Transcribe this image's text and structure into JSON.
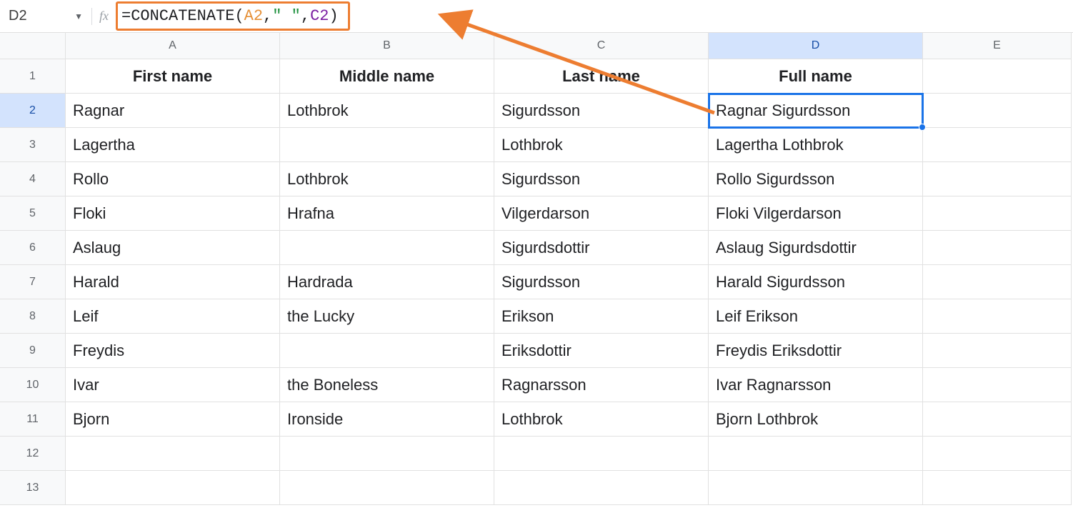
{
  "formula_bar": {
    "cell_ref": "D2",
    "formula": {
      "eq": "=",
      "fn": "CONCATENATE",
      "lp": "(",
      "refA": "A2",
      "c1": ",",
      "str": "\" \"",
      "c2": ",",
      "refC": "C2",
      "rp": ")"
    }
  },
  "columns": [
    "A",
    "B",
    "C",
    "D",
    "E"
  ],
  "active_col_idx": 3,
  "row_labels": [
    "1",
    "2",
    "3",
    "4",
    "5",
    "6",
    "7",
    "8",
    "9",
    "10",
    "11",
    "12",
    "13"
  ],
  "active_row_idx": 1,
  "headers": [
    "First name",
    "Middle name",
    "Last name",
    "Full name",
    ""
  ],
  "grid": [
    [
      "Ragnar",
      "Lothbrok",
      "Sigurdsson",
      "Ragnar Sigurdsson",
      ""
    ],
    [
      "Lagertha",
      "",
      "Lothbrok",
      "Lagertha Lothbrok",
      ""
    ],
    [
      "Rollo",
      "Lothbrok",
      "Sigurdsson",
      "Rollo Sigurdsson",
      ""
    ],
    [
      "Floki",
      "Hrafna",
      "Vilgerdarson",
      "Floki Vilgerdarson",
      ""
    ],
    [
      "Aslaug",
      "",
      "Sigurdsdottir",
      "Aslaug Sigurdsdottir",
      ""
    ],
    [
      "Harald",
      "Hardrada",
      "Sigurdsson",
      "Harald Sigurdsson",
      ""
    ],
    [
      "Leif",
      "the Lucky",
      "Erikson",
      "Leif Erikson",
      ""
    ],
    [
      "Freydis",
      "",
      "Eriksdottir",
      "Freydis Eriksdottir",
      ""
    ],
    [
      "Ivar",
      "the Boneless",
      "Ragnarsson",
      "Ivar Ragnarsson",
      ""
    ],
    [
      "Bjorn",
      "Ironside",
      "Lothbrok",
      "Bjorn Lothbrok",
      ""
    ],
    [
      "",
      "",
      "",
      "",
      ""
    ],
    [
      "",
      "",
      "",
      "",
      ""
    ]
  ],
  "selected": {
    "row": 1,
    "col": 3
  }
}
